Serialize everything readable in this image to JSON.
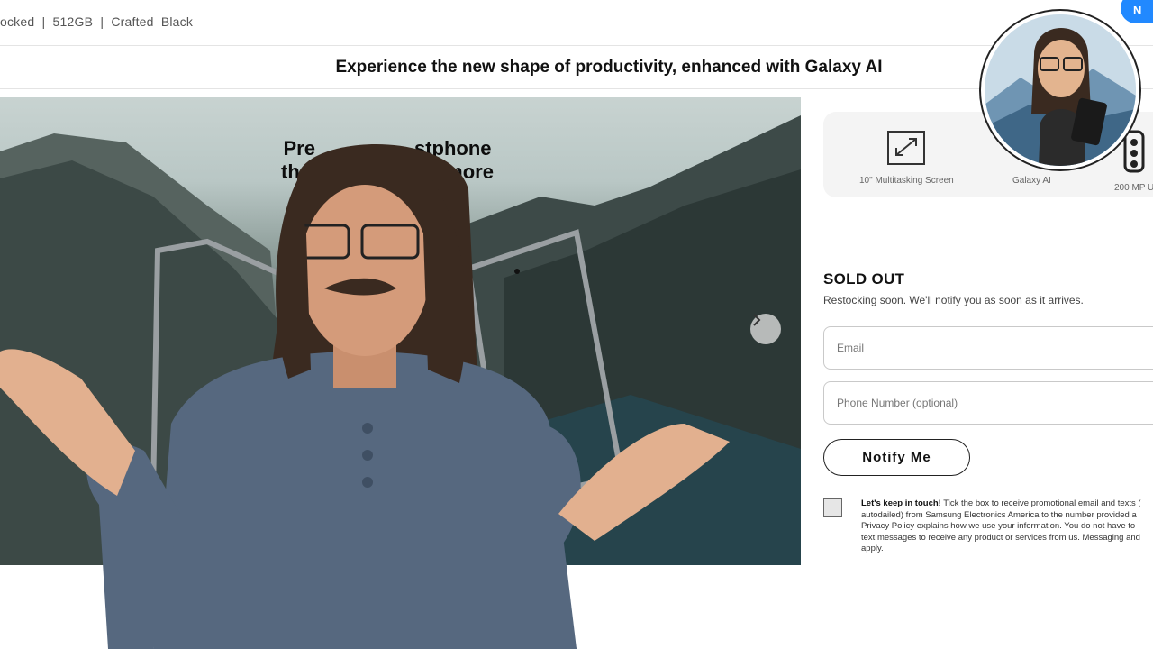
{
  "topbar": {
    "spec_text": "ocked  |  512GB  |  Crafted  Black",
    "button_label": "N"
  },
  "promo": {
    "text": "Experience the new shape of productivity, enhanced with Galaxy AI"
  },
  "hero": {
    "headline_line1": "Pre     stphone",
    "headline_line2": "that     en more",
    "next_icon": "chevron-right-icon"
  },
  "features": [
    {
      "label": "10\" Multitasking Screen",
      "icon": "resize-screen-icon"
    },
    {
      "label": "Galaxy AI",
      "icon": "galaxy-ai-icon"
    },
    {
      "label": "200 MP U",
      "icon": "camera-icon"
    }
  ],
  "stock": {
    "title": "SOLD OUT",
    "subtitle": "Restocking soon. We'll notify you as soon as it arrives."
  },
  "form": {
    "email_placeholder": "Email",
    "phone_placeholder": "Phone Number (optional)",
    "notify_label": "Notify Me"
  },
  "consent": {
    "bold": "Let's keep in touch!",
    "line1": " Tick the box to receive promotional email and texts (",
    "line2": "autodailed) from Samsung Electronics America to the number provided a",
    "line3": "Privacy Policy explains how we use your information. You do not have to",
    "line4": "text messages to receive any product or services from us. Messaging and",
    "line5": "apply."
  },
  "colors": {
    "accent_blue": "#2189ff",
    "shirt": "#56687f"
  }
}
